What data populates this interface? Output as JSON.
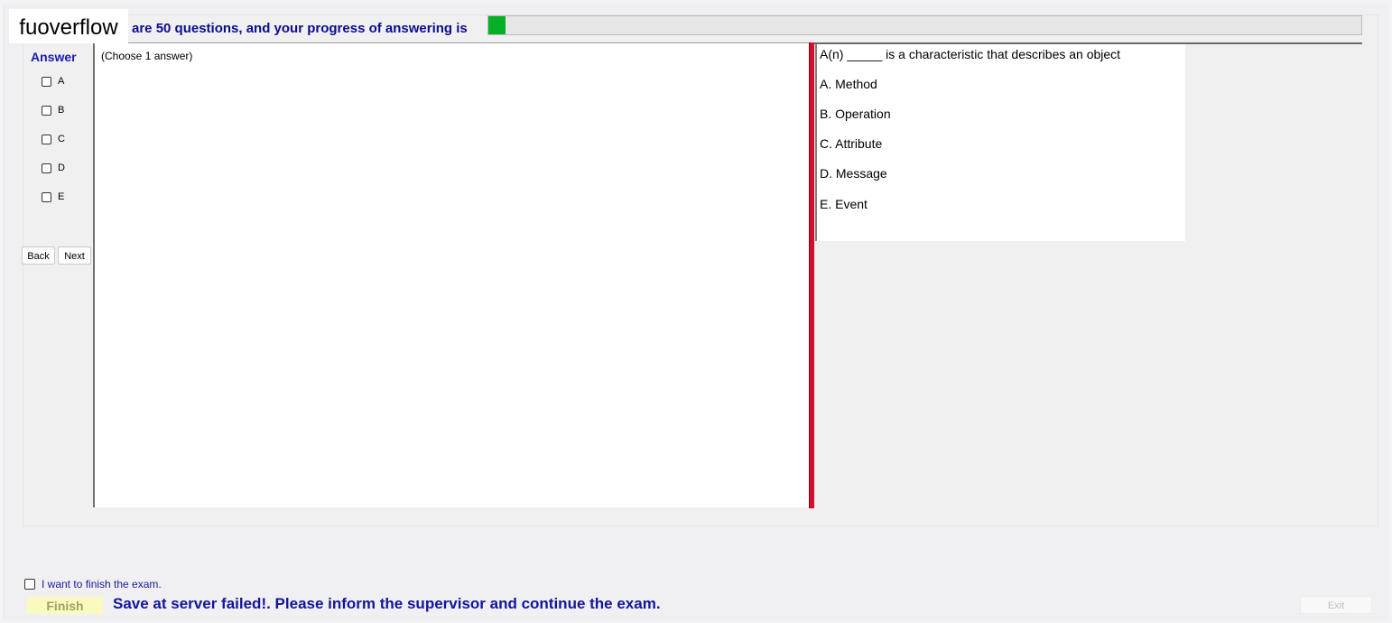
{
  "watermark": "fuoverflow",
  "progress": {
    "text": "are 50 questions, and your progress of answering is",
    "fraction": 0.02,
    "fill_color": "#06b025"
  },
  "answer": {
    "title": "Answer",
    "options": [
      "A",
      "B",
      "C",
      "D",
      "E"
    ]
  },
  "nav": {
    "back_label": "Back",
    "next_label": "Next"
  },
  "answer_panel": {
    "hint": "(Choose 1 answer)"
  },
  "question": {
    "text": "A(n) _____ is a characteristic that describes an object",
    "options": [
      "A.  Method",
      "B.  Operation",
      "C.  Attribute",
      "D.  Message",
      "E.  Event"
    ]
  },
  "footer": {
    "finish_check_label": "I want to finish the exam.",
    "finish_label": "Finish",
    "status_message": "Save at server failed!. Please inform the supervisor and continue the exam.",
    "exit_label": "Exit"
  }
}
